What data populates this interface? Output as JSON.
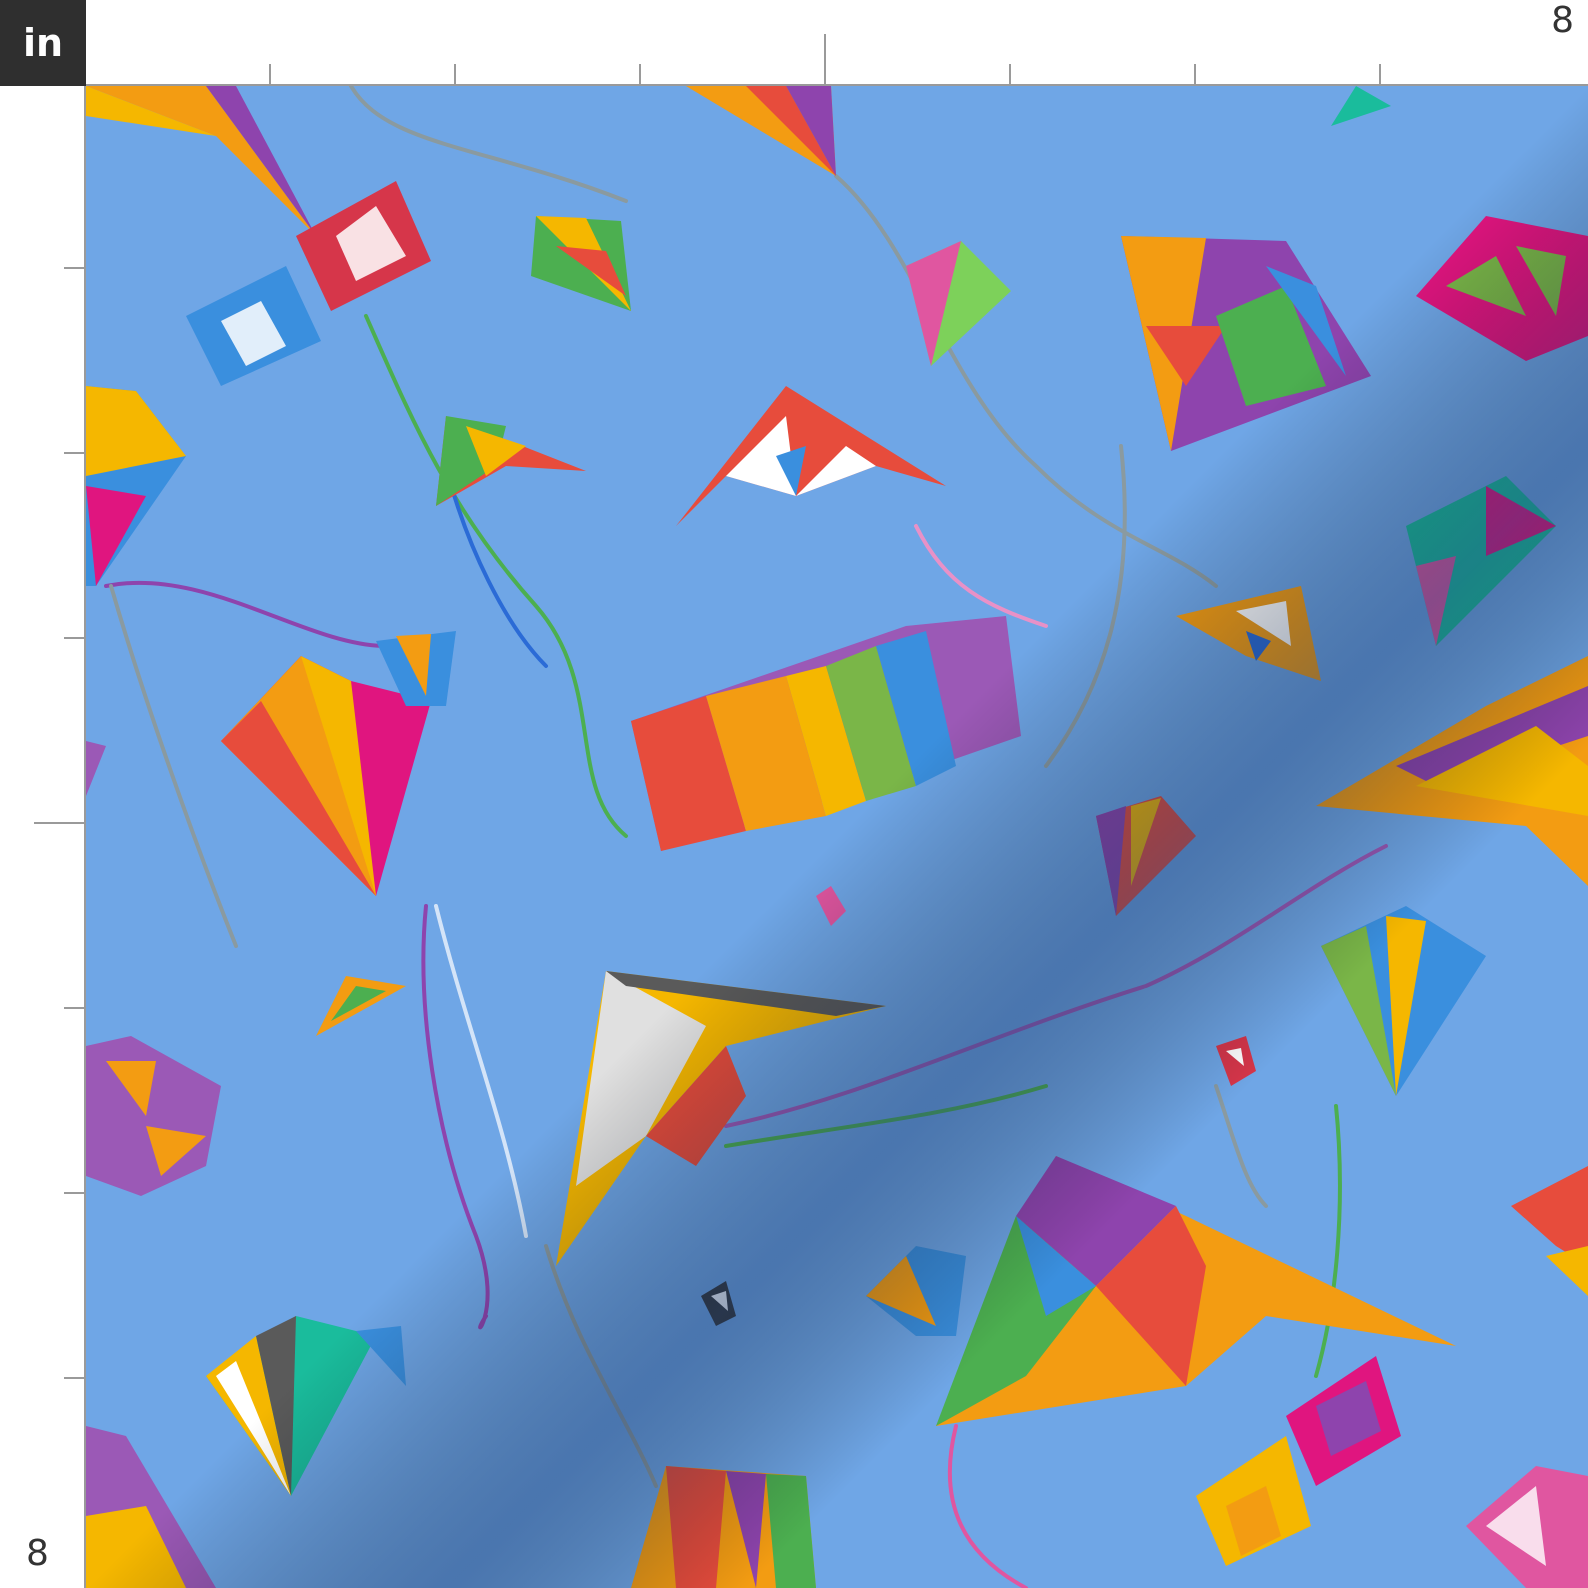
{
  "ruler": {
    "unit_label": "in",
    "top_end_label": "8",
    "left_end_label": "8"
  },
  "colors": {
    "sky": "#6fa6e6",
    "sky_shadow": "#4f7fbf",
    "ruler_bg": "#ffffff",
    "badge_bg": "#2f2f2f"
  },
  "fabric": {
    "pattern": "kites-in-blue-sky"
  }
}
